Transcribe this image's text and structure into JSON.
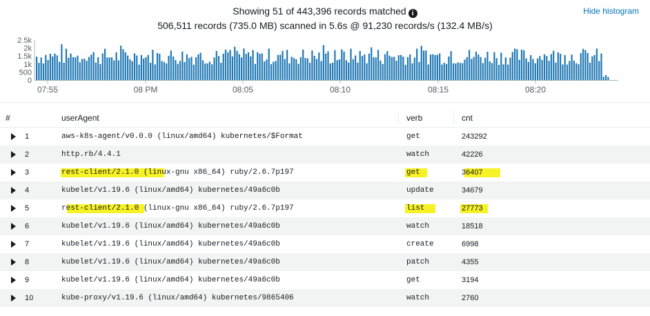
{
  "summary": {
    "matched": "Showing 51 of 443,396 records matched",
    "scanned": "506,511 records (735.0 MB) scanned in 5.6s @ 91,230 records/s (132.4 MB/s)"
  },
  "hide_histogram_label": "Hide histogram",
  "histogram": {
    "color": "#1f77b4",
    "y_ticks": [
      "2.5k",
      "2k",
      "1.5k",
      "1k",
      "500",
      "0"
    ],
    "x_ticks": [
      "07:55",
      "08 PM",
      "08:05",
      "08:10",
      "08:15",
      "08:20"
    ]
  },
  "table": {
    "headers": {
      "index": "#",
      "user_agent": "userAgent",
      "verb": "verb",
      "cnt": "cnt"
    },
    "rows": [
      {
        "index": "1",
        "user_agent": "aws-k8s-agent/v0.0.0 (linux/amd64) kubernetes/$Format",
        "verb": "get",
        "cnt": "243292"
      },
      {
        "index": "2",
        "user_agent": "http.rb/4.4.1",
        "verb": "watch",
        "cnt": "42226"
      },
      {
        "index": "3",
        "user_agent": "rest-client/2.1.0 (linux-gnu x86_64) ruby/2.6.7p197",
        "verb": "get",
        "cnt": "36407"
      },
      {
        "index": "4",
        "user_agent": "kubelet/v1.19.6 (linux/amd64) kubernetes/49a6c0b",
        "verb": "update",
        "cnt": "34679"
      },
      {
        "index": "5",
        "user_agent": "rest-client/2.1.0 (linux-gnu x86_64) ruby/2.6.7p197",
        "verb": "list",
        "cnt": "27773"
      },
      {
        "index": "6",
        "user_agent": "kubelet/v1.19.6 (linux/amd64) kubernetes/49a6c0b",
        "verb": "watch",
        "cnt": "18518"
      },
      {
        "index": "7",
        "user_agent": "kubelet/v1.19.6 (linux/amd64) kubernetes/49a6c0b",
        "verb": "create",
        "cnt": "6998"
      },
      {
        "index": "8",
        "user_agent": "kubelet/v1.19.6 (linux/amd64) kubernetes/49a6c0b",
        "verb": "patch",
        "cnt": "4355"
      },
      {
        "index": "9",
        "user_agent": "kubelet/v1.19.6 (linux/amd64) kubernetes/49a6c0b",
        "verb": "get",
        "cnt": "3194"
      },
      {
        "index": "10",
        "user_agent": "kube-proxy/v1.19.6 (linux/amd64) kubernetes/9865406",
        "verb": "watch",
        "cnt": "2760"
      }
    ]
  }
}
